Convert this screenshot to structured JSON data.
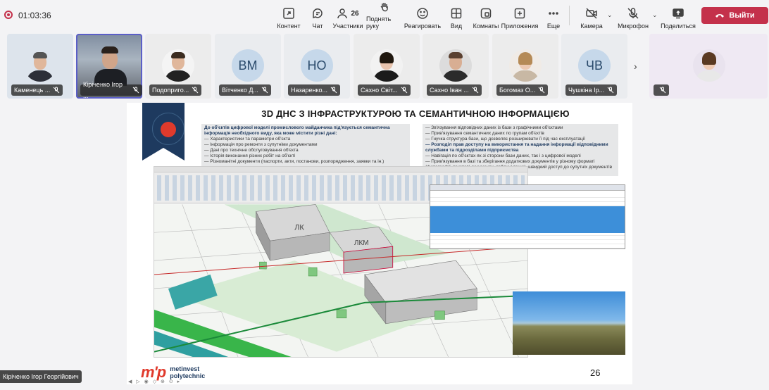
{
  "recording": {
    "timer": "01:03:36"
  },
  "toolbar": {
    "content": "Контент",
    "chat": "Чат",
    "participants": "Участники",
    "participants_count": "26",
    "raise_hand": "Поднять руку",
    "react": "Реагировать",
    "view": "Вид",
    "rooms": "Комнаты",
    "apps": "Приложения",
    "more": "Еще",
    "camera": "Камера",
    "mic": "Микрофон",
    "share": "Поделиться",
    "leave": "Выйти"
  },
  "participants": [
    {
      "name": "Каменець ...",
      "type": "photo",
      "bg": "#dde4ec"
    },
    {
      "name": "Кіріченко Ігор ...",
      "type": "video",
      "bg": "#9aa7b5"
    },
    {
      "name": "Подопригo...",
      "type": "photo",
      "bg": "#ececec"
    },
    {
      "name": "Вітченко Д...",
      "type": "initials",
      "initials": "ВМ",
      "bg": "#eaecef"
    },
    {
      "name": "Назаренко...",
      "type": "initials",
      "initials": "НО",
      "bg": "#eaecef"
    },
    {
      "name": "Сахно Світ...",
      "type": "photo",
      "bg": "#ececec"
    },
    {
      "name": "Сахно Іван ...",
      "type": "photo",
      "bg": "#ececec"
    },
    {
      "name": "Богомаз О...",
      "type": "photo",
      "bg": "#ececec"
    },
    {
      "name": "Чушкіна Ір...",
      "type": "initials",
      "initials": "ЧВ",
      "bg": "#eaecef"
    },
    {
      "name": "",
      "type": "photo",
      "bg": "#efe9f3"
    }
  ],
  "slide": {
    "title": "3D ДНС З ІНФРАСТРУКТУРОЮ ТА СЕМАНТИЧНОЮ ІНФОРМАЦІЄЮ",
    "left_intro": "До об'єктів цифрової моделі промислового майданчика під'язується семантична інформація необхідного виду, яка може містити різні дані:",
    "left_items": [
      "— Характеристики та параметри об'єкта",
      "— Інформація про ремонти з супутніми документами",
      "— Дані про технічне обслуговування об'єкта",
      "— Історія виконання різних робіт на об'єкті",
      "— Різноманітні документи (паспорти, акти, постанови, розпорядження, заявки та ін.)"
    ],
    "right_items": [
      "— Зв'язування відповідних даних із бази з графічними об'єктами",
      "— Прив'язування семантичних даних по групам об'єктів",
      "— Гнучка структура бази, що дозволяє розширювати її під час експлуатації",
      "— Розподіл прав доступу на використання та надання інформації відповідними службами та підрозділами підприємства",
      "— Навігація по об'єктах як зі сторони бази даних, так і з цифрової моделі",
      "— Прив'язування в базі та зберігання додаткових документів у різному форматі (фотографії, текстові документи, таблиці тощо), швидкий доступ до супутніх документів"
    ],
    "building_label_1": "ЛК",
    "building_label_2": "ЛКМ",
    "logo_mark": "m'p",
    "logo_line1": "metinvest",
    "logo_line2": "polytechnic",
    "page_number": "26"
  },
  "presenter_tag": "Кіріченко Ігор Георгійович",
  "colors": {
    "leave": "#c4314b",
    "accent": "#5b5fc7",
    "slide_red": "#e03a2c",
    "slide_navy": "#1e3a5f"
  }
}
